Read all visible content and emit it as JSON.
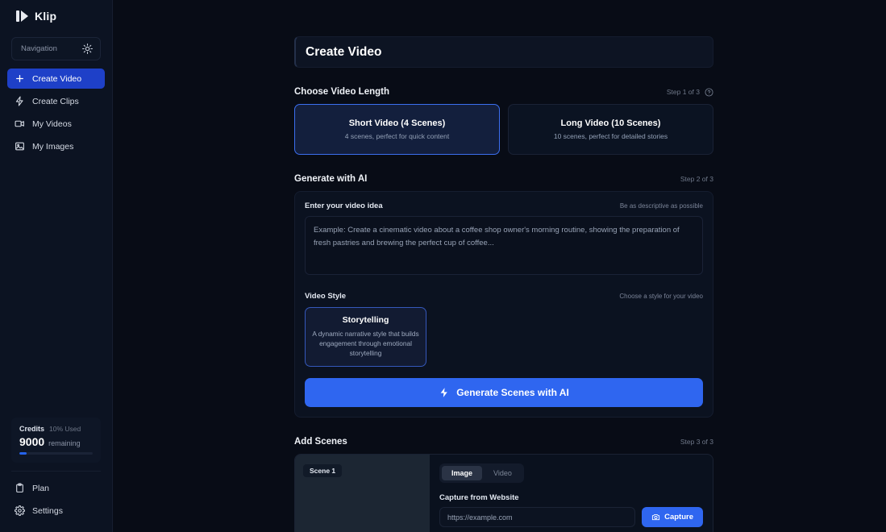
{
  "brand": {
    "name": "Klip",
    "logo_icon": "klip-logo-icon"
  },
  "sidebar": {
    "nav_box": {
      "label": "Navigation",
      "icon": "sun-icon"
    },
    "items": [
      {
        "label": "Create Video",
        "icon": "plus-icon",
        "active": true
      },
      {
        "label": "Create Clips",
        "icon": "bolt-icon",
        "active": false
      },
      {
        "label": "My Videos",
        "icon": "video-camera-icon",
        "active": false
      },
      {
        "label": "My Images",
        "icon": "image-icon",
        "active": false
      }
    ],
    "credits": {
      "title": "Credits",
      "used_label": "10% Used",
      "amount": "9000",
      "remaining_label": "remaining",
      "percent_used": 10,
      "bar_color": "#2563eb"
    },
    "bottom_items": [
      {
        "label": "Plan",
        "icon": "clipboard-icon"
      },
      {
        "label": "Settings",
        "icon": "gear-icon"
      }
    ]
  },
  "main": {
    "page_title": "Create Video",
    "step1": {
      "title": "Choose Video Length",
      "step_label": "Step 1 of 3",
      "help_icon": "help-circle-icon",
      "options": [
        {
          "title": "Short Video (4 Scenes)",
          "subtitle": "4 scenes, perfect for quick content",
          "selected": true
        },
        {
          "title": "Long Video (10 Scenes)",
          "subtitle": "10 scenes, perfect for detailed stories",
          "selected": false
        }
      ]
    },
    "step2": {
      "title": "Generate with AI",
      "step_label": "Step 2 of 3",
      "idea_field": {
        "label": "Enter your video idea",
        "hint": "Be as descriptive as possible",
        "value": "",
        "placeholder": "Example: Create a cinematic video about a coffee shop owner's morning routine, showing the preparation of fresh pastries and brewing the perfect cup of coffee..."
      },
      "style_field": {
        "label": "Video Style",
        "hint": "Choose a style for your video",
        "options": [
          {
            "title": "Storytelling",
            "description": "A dynamic narrative style that builds engagement through emotional storytelling",
            "selected": true
          }
        ]
      },
      "generate_button": {
        "label": "Generate Scenes with AI",
        "icon": "bolt-icon",
        "color": "#2f66f0"
      }
    },
    "step3": {
      "title": "Add Scenes",
      "step_label": "Step 3 of 3",
      "scene": {
        "badge": "Scene 1",
        "tabs": [
          {
            "label": "Image",
            "active": true
          },
          {
            "label": "Video",
            "active": false
          }
        ],
        "capture": {
          "label": "Capture from Website",
          "value": "",
          "placeholder": "https://example.com",
          "button_label": "Capture",
          "button_icon": "camera-icon"
        }
      }
    }
  }
}
